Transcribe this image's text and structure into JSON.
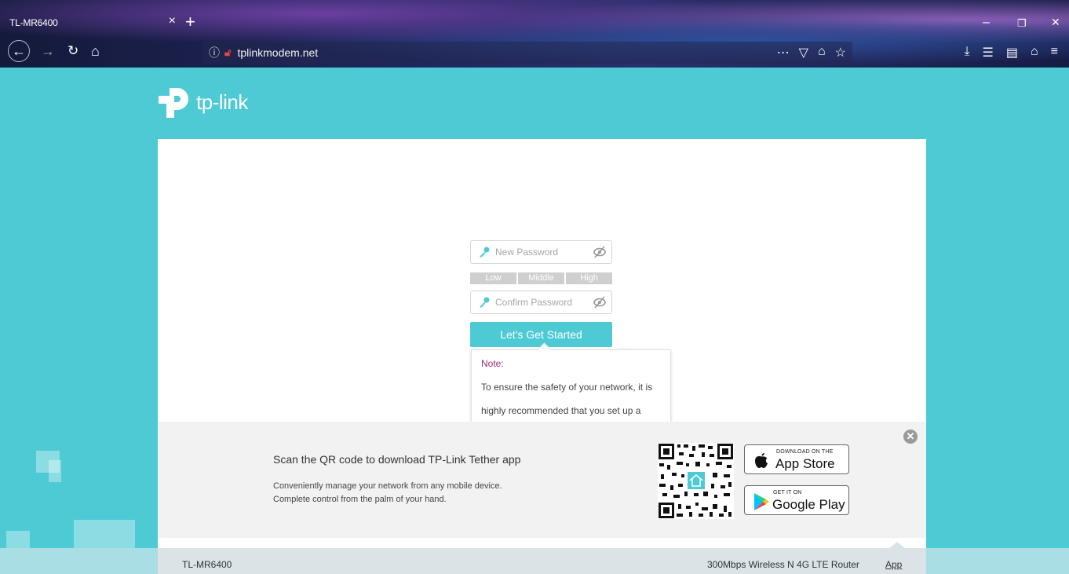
{
  "browser": {
    "tab_title": "TL-MR6400",
    "tab_close": "×",
    "new_tab": "+",
    "url": "tplinkmodem.net",
    "window_minimize": "–",
    "window_restore": "❐",
    "window_close": "✕"
  },
  "logo": {
    "text": "tp-link",
    "color": "#ffffff"
  },
  "form": {
    "new_password_placeholder": "New Password",
    "confirm_password_placeholder": "Confirm Password",
    "strength_levels": [
      "Low",
      "Middle",
      "High"
    ],
    "submit_label": "Let's Get Started"
  },
  "note": {
    "title": "Note:",
    "lines": [
      "To ensure the safety of your network, it is",
      "highly recommended that you set up a"
    ]
  },
  "app_banner": {
    "title": "Scan the QR code to download TP-Link Tether app",
    "line1": "Conveniently manage your network from any mobile device.",
    "line2": "Complete control from the palm of your hand.",
    "app_store_small": "DOWNLOAD ON THE",
    "app_store_big": "App Store",
    "google_play_small": "GET IT ON",
    "google_play_big": "Google Play",
    "close": "✕"
  },
  "footer": {
    "model": "TL-MR6400",
    "description": "300Mbps Wireless N 4G LTE Router",
    "app_link": "App"
  },
  "colors": {
    "accent": "#4ecad5",
    "note_title": "#9c2c7a",
    "strength_bar": "#cfcfcf"
  }
}
